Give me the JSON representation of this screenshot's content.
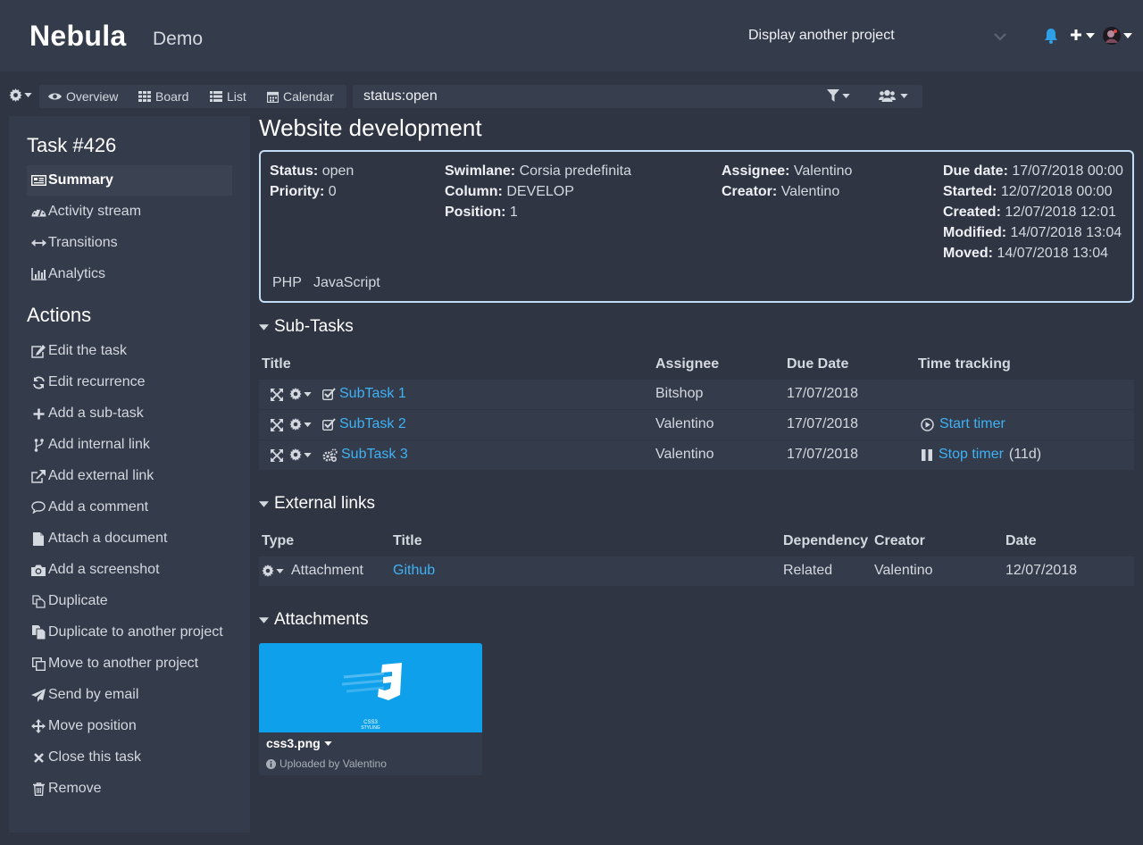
{
  "header": {
    "logo": "Nebula",
    "project": "Demo",
    "project_selector": "Display another project"
  },
  "toolbar": {
    "views": [
      "Overview",
      "Board",
      "List",
      "Calendar"
    ],
    "filter_value": "status:open"
  },
  "sidebar": {
    "task_heading": "Task #426",
    "task_items": [
      {
        "label": "Summary",
        "icon": "summary-icon"
      },
      {
        "label": "Activity stream",
        "icon": "dashboard-icon"
      },
      {
        "label": "Transitions",
        "icon": "arrows-h-icon"
      },
      {
        "label": "Analytics",
        "icon": "bar-chart-icon"
      }
    ],
    "actions_heading": "Actions",
    "actions": [
      {
        "label": "Edit the task",
        "icon": "edit-icon"
      },
      {
        "label": "Edit recurrence",
        "icon": "refresh-icon"
      },
      {
        "label": "Add a sub-task",
        "icon": "plus-icon"
      },
      {
        "label": "Add internal link",
        "icon": "code-fork-icon"
      },
      {
        "label": "Add external link",
        "icon": "external-link-icon"
      },
      {
        "label": "Add a comment",
        "icon": "comment-icon"
      },
      {
        "label": "Attach a document",
        "icon": "file-icon"
      },
      {
        "label": "Add a screenshot",
        "icon": "camera-icon"
      },
      {
        "label": "Duplicate",
        "icon": "files-icon"
      },
      {
        "label": "Duplicate to another project",
        "icon": "copy-icon"
      },
      {
        "label": "Move to another project",
        "icon": "clone-icon"
      },
      {
        "label": "Send by email",
        "icon": "paper-plane-icon"
      },
      {
        "label": "Move position",
        "icon": "arrows-icon"
      },
      {
        "label": "Close this task",
        "icon": "times-icon"
      },
      {
        "label": "Remove",
        "icon": "trash-icon"
      }
    ]
  },
  "task": {
    "title": "Website development",
    "fields": {
      "status": {
        "label": "Status:",
        "value": "open"
      },
      "priority": {
        "label": "Priority:",
        "value": "0"
      },
      "swimlane": {
        "label": "Swimlane:",
        "value": "Corsia predefinita"
      },
      "column": {
        "label": "Column:",
        "value": "DEVELOP"
      },
      "position": {
        "label": "Position:",
        "value": "1"
      },
      "assignee": {
        "label": "Assignee:",
        "value": "Valentino"
      },
      "creator": {
        "label": "Creator:",
        "value": "Valentino"
      },
      "due_date": {
        "label": "Due date:",
        "value": "17/07/2018 00:00"
      },
      "started": {
        "label": "Started:",
        "value": "12/07/2018 00:00"
      },
      "created": {
        "label": "Created:",
        "value": "12/07/2018 12:01"
      },
      "modified": {
        "label": "Modified:",
        "value": "14/07/2018 13:04"
      },
      "moved": {
        "label": "Moved:",
        "value": "14/07/2018 13:04"
      }
    },
    "tags": [
      "PHP",
      "JavaScript"
    ]
  },
  "subtasks": {
    "heading": "Sub-Tasks",
    "columns": [
      "Title",
      "Assignee",
      "Due Date",
      "Time tracking"
    ],
    "rows": [
      {
        "title": "SubTask 1",
        "status_icon": "check-square-icon",
        "assignee": "Bitshop",
        "due": "17/07/2018",
        "timer": "",
        "timer_extra": ""
      },
      {
        "title": "SubTask 2",
        "status_icon": "check-square-icon",
        "assignee": "Valentino",
        "due": "17/07/2018",
        "timer": "Start timer",
        "timer_extra": ""
      },
      {
        "title": "SubTask 3",
        "status_icon": "cogs-icon",
        "assignee": "Valentino",
        "due": "17/07/2018",
        "timer": "Stop timer",
        "timer_extra": "(11d)"
      }
    ]
  },
  "external_links": {
    "heading": "External links",
    "columns": [
      "Type",
      "Title",
      "Dependency",
      "Creator",
      "Date"
    ],
    "rows": [
      {
        "type": "Attachment",
        "title": "Github",
        "dependency": "Related",
        "creator": "Valentino",
        "date": "12/07/2018"
      }
    ]
  },
  "attachments": {
    "heading": "Attachments",
    "items": [
      {
        "filename": "css3.png",
        "uploaded": "Uploaded by Valentino",
        "thumb_caption_1": "CSS3",
        "thumb_caption_2": "STYLING"
      }
    ]
  },
  "colors": {
    "background": "#2f3543",
    "panel": "#343b4a",
    "link": "#3fb2f5",
    "bell": "#2e9fe6",
    "summary_border": "#c2dcf5"
  }
}
